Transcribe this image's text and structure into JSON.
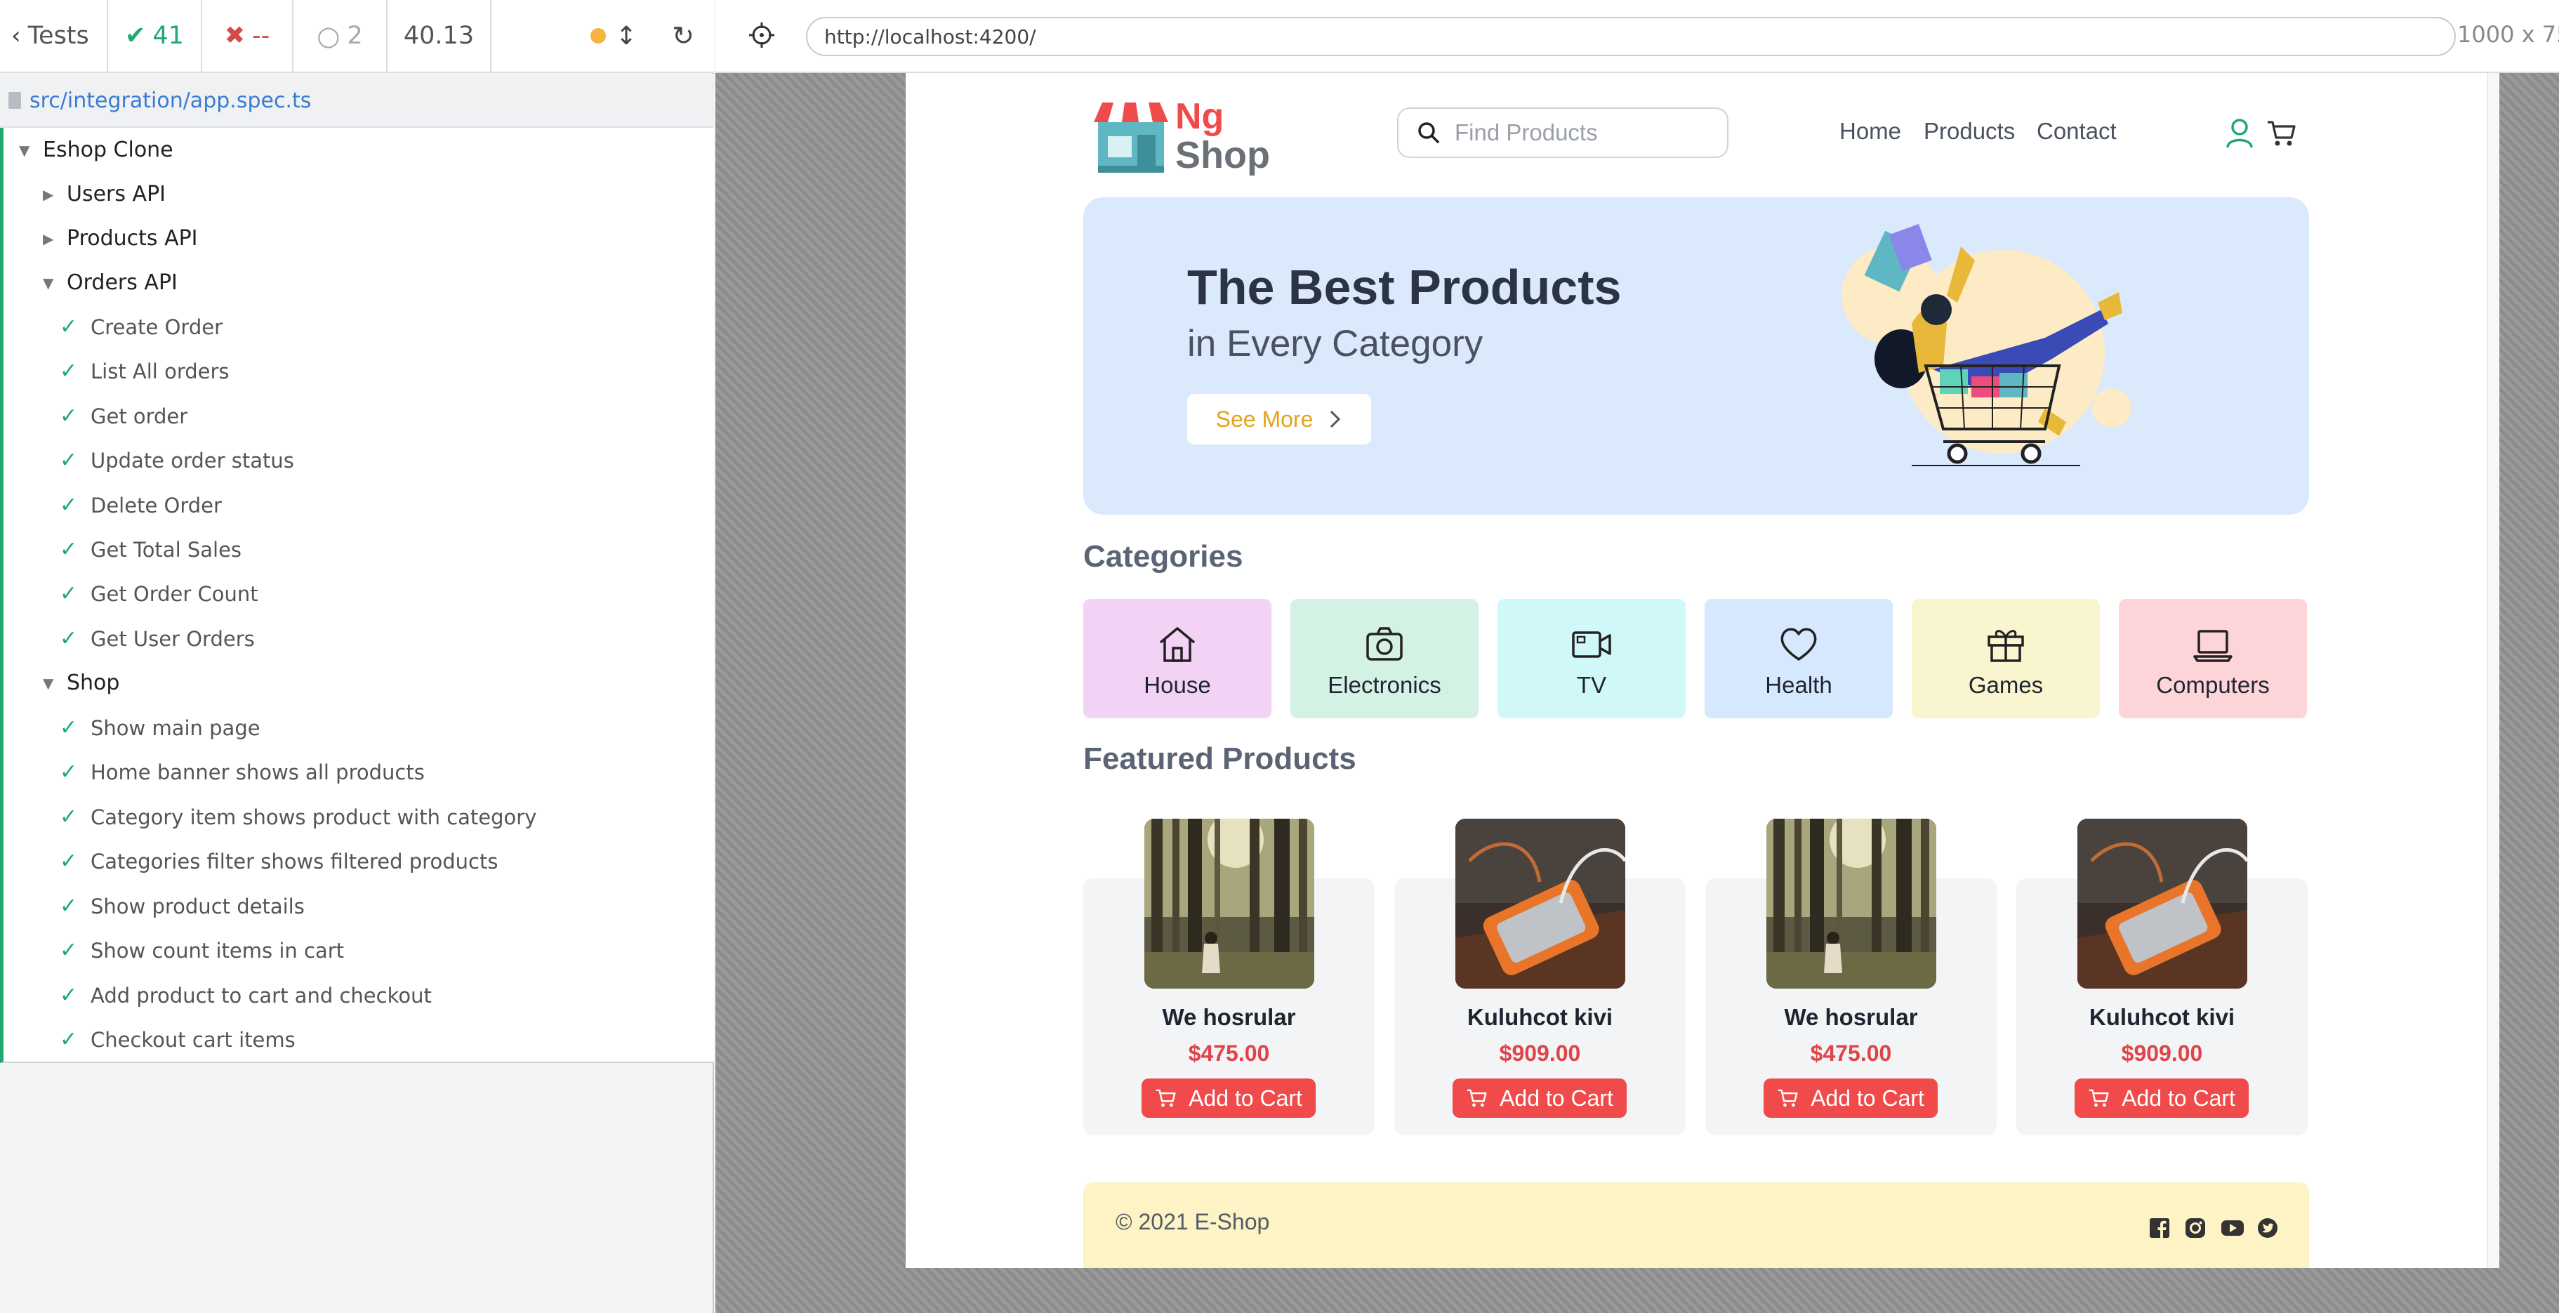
{
  "runner": {
    "tests_label": "Tests",
    "passed": "41",
    "failed": "--",
    "pending": "2",
    "duration": "40.13",
    "spec_path": "src/integration/app.spec.ts"
  },
  "tree": {
    "root": "Eshop Clone",
    "suites": [
      {
        "label": "Users API"
      },
      {
        "label": "Products API"
      },
      {
        "label": "Orders API"
      },
      {
        "label": "Shop"
      }
    ],
    "orders_tests": [
      "Create Order",
      "List All orders",
      "Get order",
      "Update order status",
      "Delete Order",
      "Get Total Sales",
      "Get Order Count",
      "Get User Orders"
    ],
    "shop_tests": [
      "Show main page",
      "Home banner shows all products",
      "Category item shows product with category",
      "Categories filter shows filtered products",
      "Show product details",
      "Show count items in cart",
      "Add product to cart and checkout",
      "Checkout cart items"
    ]
  },
  "browser": {
    "url": "http://localhost:4200/",
    "viewport": "1000 x 75"
  },
  "shop": {
    "logo": {
      "line1": "Ng",
      "line2": "Shop"
    },
    "search_placeholder": "Find Products",
    "nav": [
      "Home",
      "Products",
      "Contact"
    ],
    "banner": {
      "title": "The Best Products",
      "subtitle": "in Every Category",
      "button": "See More"
    },
    "categories_title": "Categories",
    "categories": [
      {
        "name": "House",
        "color": "#f2d3f5",
        "icon": "house-icon"
      },
      {
        "name": "Electronics",
        "color": "#d3f2e4",
        "icon": "camera-icon"
      },
      {
        "name": "TV",
        "color": "#d1f8f9",
        "icon": "video-icon"
      },
      {
        "name": "Health",
        "color": "#d6e8fd",
        "icon": "heart-icon"
      },
      {
        "name": "Games",
        "color": "#f9f6cf",
        "icon": "gift-icon"
      },
      {
        "name": "Computers",
        "color": "#fdd5d8",
        "icon": "laptop-icon"
      }
    ],
    "featured_title": "Featured Products",
    "products": [
      {
        "name": "We hosrular",
        "price": "$475.00",
        "image": "forest-photo"
      },
      {
        "name": "Kuluhcot kivi",
        "price": "$909.00",
        "image": "hard-drive-photo"
      },
      {
        "name": "We hosrular",
        "price": "$475.00",
        "image": "forest-photo"
      },
      {
        "name": "Kuluhcot kivi",
        "price": "$909.00",
        "image": "hard-drive-photo"
      }
    ],
    "add_to_cart": "Add to Cart",
    "footer": "© 2021 E-Shop"
  }
}
